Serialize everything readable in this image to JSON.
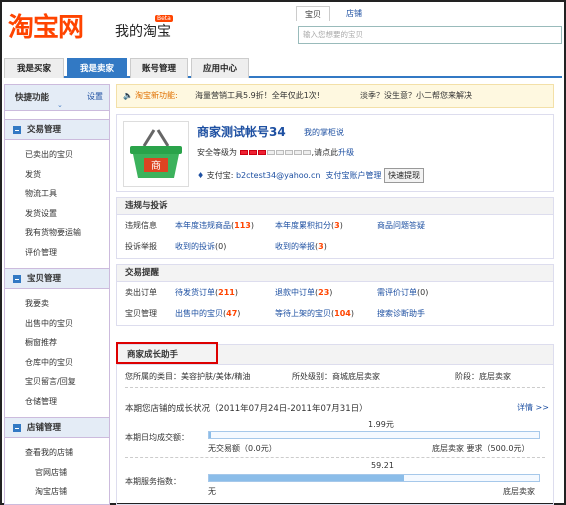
{
  "header": {
    "logo": "淘宝网",
    "title": "我的淘宝",
    "beta": "Beta",
    "search": {
      "tabs": [
        "宝贝",
        "店铺"
      ],
      "placeholder": "输入您想要的宝贝"
    }
  },
  "nav": {
    "tabs": [
      "我是买家",
      "我是卖家",
      "账号管理",
      "应用中心"
    ],
    "active": 1
  },
  "sidebar": {
    "quick_title": "快捷功能",
    "quick_settings": "设置",
    "groups": [
      {
        "title": "交易管理",
        "items": [
          "已卖出的宝贝",
          "发货",
          "物流工具",
          "发货设置",
          "我有货物要运输",
          "评价管理"
        ]
      },
      {
        "title": "宝贝管理",
        "items": [
          "我要卖",
          "出售中的宝贝",
          "橱窗推荐",
          "仓库中的宝贝",
          "宝贝留言/回复",
          "仓储管理"
        ]
      },
      {
        "title": "店铺管理",
        "items": [
          "查看我的店铺",
          "官网店铺",
          "淘宝店铺"
        ]
      }
    ]
  },
  "notice": {
    "label": "淘宝新功能:",
    "text1": "海量营销工具5.9折！全年仅此1次!",
    "text2": "淡季？没生意？小二帮您来解决"
  },
  "profile": {
    "name": "商家测试帐号34",
    "store_link": "我的掌柜说",
    "safety_label": "安全等级为",
    "safety_level_filled": 3,
    "safety_level_total": 8,
    "safety_suffix": ",请点此",
    "safety_upgrade": "升级",
    "alipay_label": "支付宝:",
    "alipay_email": "b2ctest34@yahoo.cn",
    "alipay_manage": "支付宝账户管理",
    "withdraw": "快速提现",
    "avatar_text": "商"
  },
  "violations": {
    "title": "违规与投诉",
    "rows": [
      [
        {
          "t": "违规信息"
        },
        {
          "t": "本年度违规商品",
          "c": "113"
        },
        {
          "t": "本年度累积扣分",
          "c": "3"
        },
        {
          "t": "商品问题答疑"
        }
      ],
      [
        {
          "t": "投诉举报"
        },
        {
          "t": "收到的投诉",
          "c": "0"
        },
        {
          "t": "收到的举报",
          "c": "3"
        }
      ]
    ]
  },
  "trade": {
    "title": "交易提醒",
    "rows": [
      [
        {
          "t": "卖出订单"
        },
        {
          "t": "待发货订单",
          "c": "211"
        },
        {
          "t": "退款中订单",
          "c": "23"
        },
        {
          "t": "需评价订单",
          "c": "0"
        }
      ],
      [
        {
          "t": "宝贝管理"
        },
        {
          "t": "出售中的宝贝",
          "c": "47"
        },
        {
          "t": "等待上架的宝贝",
          "c": "104"
        },
        {
          "t": "搜索诊断助手"
        }
      ]
    ]
  },
  "growth": {
    "title": "商家成长助手",
    "category_label": "您所属的类目：美容护肤/美体/精油",
    "level_label": "所处级别：商城底层卖家",
    "stage_label": "阶段：",
    "stage_value": "底层卖家",
    "period": "本期您店铺的成长状况（2011年07月24日-2011年07月31日）",
    "details": "详情 >>",
    "metrics": [
      {
        "label": "本期日均成交额：",
        "value": "1.99元",
        "fraction": 0.004,
        "left": "无交易额（0.0元）",
        "right": "底层卖家 要求（500.0元）"
      },
      {
        "label": "本期服务指数：",
        "value": "59.21",
        "fraction": 0.59,
        "left": "无",
        "right": "底层卖家"
      }
    ]
  },
  "colors": {
    "brand": "#ff4400",
    "nav_active": "#3279c4",
    "count": "#ff4400",
    "link": "#1e50a2"
  }
}
